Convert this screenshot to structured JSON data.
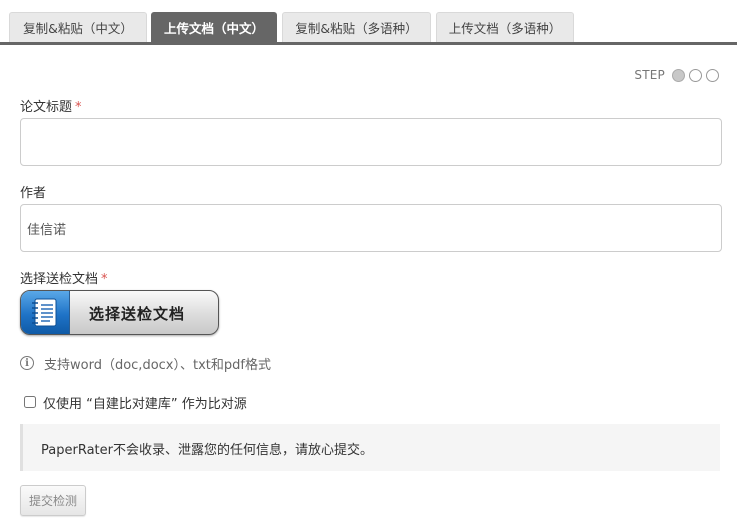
{
  "tabs": [
    {
      "label": "复制&粘贴（中文）",
      "active": false
    },
    {
      "label": "上传文档（中文）",
      "active": true
    },
    {
      "label": "复制&粘贴（多语种）",
      "active": false
    },
    {
      "label": "上传文档（多语种）",
      "active": false
    }
  ],
  "step": {
    "label": "STEP",
    "current": 1,
    "total": 3
  },
  "form": {
    "title_label": "论文标题",
    "title_value": "",
    "author_label": "作者",
    "author_value": "佳信诺",
    "file_label": "选择送检文档",
    "upload_button": "选择送检文档",
    "required_mark": "*",
    "hint": "支持word（doc,docx）、txt和pdf格式",
    "checkbox_label": "仅使用 “自建比对建库” 作为比对源",
    "checkbox_checked": false,
    "notice": "PaperRater不会收录、泄露您的任何信息，请放心提交。",
    "submit_label": "提交检测"
  },
  "colors": {
    "active_tab": "#666666",
    "required": "#d9534f",
    "upload_icon": "#1f73c7"
  }
}
